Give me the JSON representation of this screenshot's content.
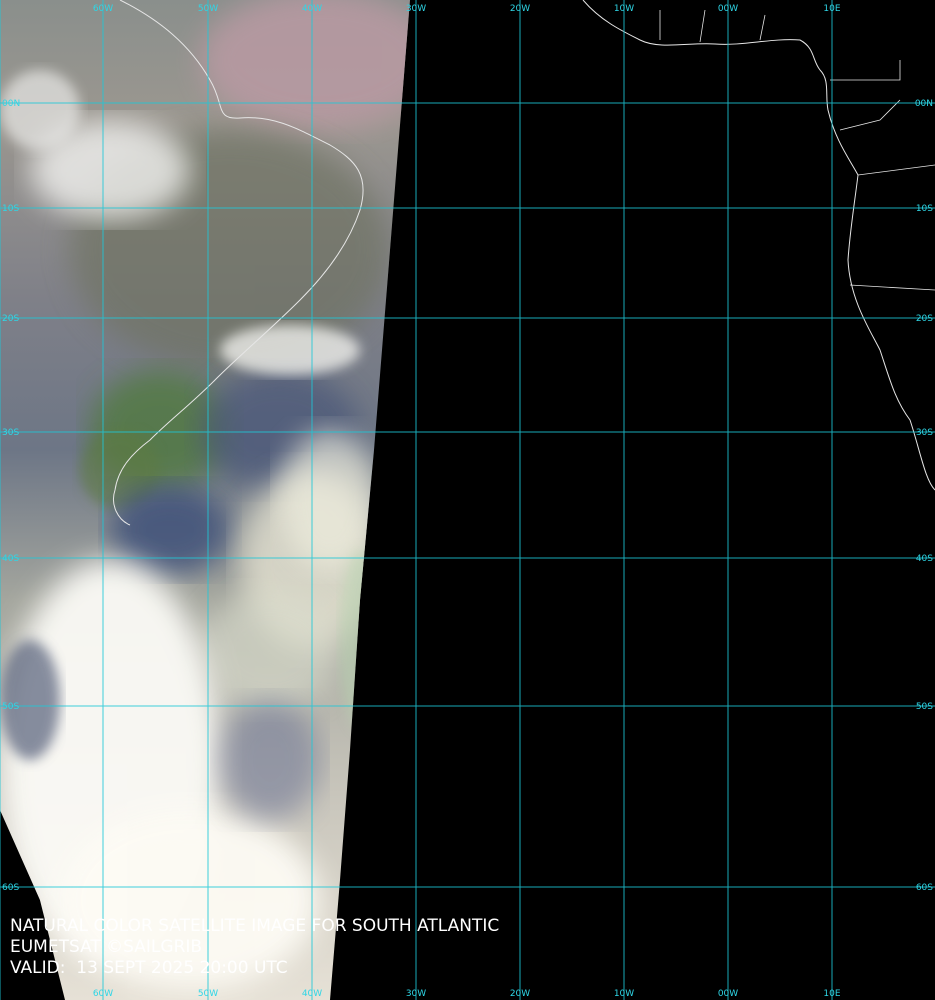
{
  "map": {
    "colors": {
      "background": "#000000",
      "graticule": "#1ec8d8",
      "graticule_label": "#2fd6e6",
      "coastline": "#e6e6e6",
      "caption_text": "#ffffff"
    },
    "longitude_labels_top": [
      "60W",
      "50W",
      "40W",
      "30W",
      "20W",
      "10W",
      "00W",
      "10E"
    ],
    "longitude_labels_bottom": [
      "60W",
      "50W",
      "40W",
      "30W",
      "20W",
      "10W",
      "00W",
      "10E"
    ],
    "latitude_labels_left": [
      "00N",
      "10S",
      "20S",
      "30S",
      "40S",
      "50S",
      "60S"
    ],
    "latitude_labels_right": [
      "00N",
      "10S",
      "20S",
      "30S",
      "40S",
      "50S",
      "60S"
    ]
  },
  "caption": {
    "line1": "NATURAL COLOR SATELLITE IMAGE FOR SOUTH ATLANTIC",
    "line2": "EUMETSAT ©SAILGRIB",
    "line3": "VALID:  13 SEPT 2025 20:00 UTC"
  }
}
